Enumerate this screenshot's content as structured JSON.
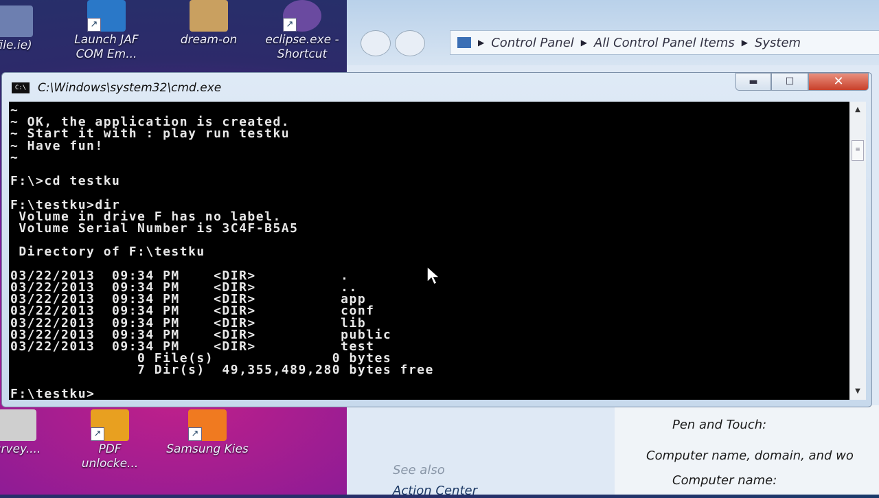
{
  "desktop": {
    "icons_top": [
      {
        "label": "file.ie)",
        "color": "#6d7fb0"
      },
      {
        "label": "Launch JAF COM Em...",
        "color": "#2a78c8"
      },
      {
        "label": "dream-on",
        "color": "#c9a060"
      },
      {
        "label": "eclipse.exe - Shortcut",
        "color": "#6a4aa0"
      }
    ],
    "icons_bottom": [
      {
        "label": "urvey....",
        "color": "#cfcfcf"
      },
      {
        "label": "PDF unlocke...",
        "color": "#e8a020"
      },
      {
        "label": "Samsung Kies",
        "color": "#f07a20"
      }
    ]
  },
  "explorer": {
    "breadcrumb": [
      "Control Panel",
      "All Control Panel Items",
      "System"
    ],
    "see_also": "See also",
    "action_center": "Action Center",
    "pen_touch": "Pen and Touch:",
    "computer_name_heading": "Computer name, domain, and wo",
    "computer_name": "Computer name:"
  },
  "cmd": {
    "title": "C:\\Windows\\system32\\cmd.exe",
    "icon_text": "C:\\",
    "minimize": "▬",
    "maximize": "☐",
    "close": "✕",
    "output": "~\n~ OK, the application is created.\n~ Start it with : play run testku\n~ Have fun!\n~\n\nF:\\>cd testku\n\nF:\\testku>dir\n Volume in drive F has no label.\n Volume Serial Number is 3C4F-B5A5\n\n Directory of F:\\testku\n\n03/22/2013  09:34 PM    <DIR>          .\n03/22/2013  09:34 PM    <DIR>          ..\n03/22/2013  09:34 PM    <DIR>          app\n03/22/2013  09:34 PM    <DIR>          conf\n03/22/2013  09:34 PM    <DIR>          lib\n03/22/2013  09:34 PM    <DIR>          public\n03/22/2013  09:34 PM    <DIR>          test\n               0 File(s)              0 bytes\n               7 Dir(s)  49,355,489,280 bytes free\n\nF:\\testku>"
  }
}
